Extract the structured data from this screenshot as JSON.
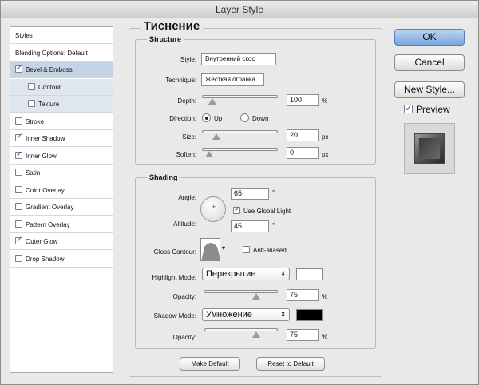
{
  "window": {
    "title": "Layer Style"
  },
  "sidebar": {
    "items": [
      {
        "label": "Styles",
        "checkbox": false,
        "checked": false,
        "selected": false,
        "sub": false
      },
      {
        "label": "Blending Options: Default",
        "checkbox": false,
        "checked": false,
        "selected": false,
        "sub": false
      },
      {
        "label": "Bevel & Emboss",
        "checkbox": true,
        "checked": true,
        "selected": true,
        "sub": false
      },
      {
        "label": "Contour",
        "checkbox": true,
        "checked": false,
        "selected": false,
        "sub": true
      },
      {
        "label": "Texture",
        "checkbox": true,
        "checked": false,
        "selected": false,
        "sub": true
      },
      {
        "label": "Stroke",
        "checkbox": true,
        "checked": false,
        "selected": false,
        "sub": false
      },
      {
        "label": "Inner Shadow",
        "checkbox": true,
        "checked": true,
        "selected": false,
        "sub": false
      },
      {
        "label": "Inner Glow",
        "checkbox": true,
        "checked": true,
        "selected": false,
        "sub": false
      },
      {
        "label": "Satin",
        "checkbox": true,
        "checked": false,
        "selected": false,
        "sub": false
      },
      {
        "label": "Color Overlay",
        "checkbox": true,
        "checked": false,
        "selected": false,
        "sub": false
      },
      {
        "label": "Gradient Overlay",
        "checkbox": true,
        "checked": false,
        "selected": false,
        "sub": false
      },
      {
        "label": "Pattern Overlay",
        "checkbox": true,
        "checked": false,
        "selected": false,
        "sub": false
      },
      {
        "label": "Outer Glow",
        "checkbox": true,
        "checked": true,
        "selected": false,
        "sub": false
      },
      {
        "label": "Drop Shadow",
        "checkbox": true,
        "checked": false,
        "selected": false,
        "sub": false
      }
    ]
  },
  "panel": {
    "title": "Тиснение"
  },
  "structure": {
    "label": "Structure",
    "style_label": "Style:",
    "style_value": "Внутренний скос",
    "technique_label": "Technique:",
    "technique_value": "Жёсткая огранка",
    "depth_label": "Depth:",
    "depth_value": "100",
    "depth_unit": "%",
    "depth_level": 0.05,
    "direction_label": "Direction:",
    "up_label": "Up",
    "down_label": "Down",
    "direction": "up",
    "size_label": "Size:",
    "size_value": "20",
    "size_unit": "px",
    "size_level": 0.12,
    "soften_label": "Soften:",
    "soften_value": "0",
    "soften_unit": "px",
    "soften_level": 0.0
  },
  "shading": {
    "label": "Shading",
    "angle_label": "Angle:",
    "angle_value": "65",
    "angle_unit": "°",
    "global_light_label": "Use Global Light",
    "global_light": true,
    "altitude_label": "Altitude:",
    "altitude_value": "45",
    "altitude_unit": "°",
    "gloss_label": "Gloss Contour:",
    "anti_aliased_label": "Anti-aliased",
    "anti_aliased": false,
    "highlight_mode_label": "Highlight Mode:",
    "highlight_mode_value": "Перекрытие",
    "highlight_color": "#ffffff",
    "highlight_opacity_label": "Opacity:",
    "highlight_opacity_value": "75",
    "highlight_opacity_unit": "%",
    "highlight_opacity_level": 0.75,
    "shadow_mode_label": "Shadow Mode:",
    "shadow_mode_value": "Умножение",
    "shadow_color": "#000000",
    "shadow_opacity_label": "Opacity:",
    "shadow_opacity_value": "75",
    "shadow_opacity_unit": "%",
    "shadow_opacity_level": 0.75
  },
  "footer": {
    "make_default": "Make Default",
    "reset_default": "Reset to Default"
  },
  "actions": {
    "ok": "OK",
    "cancel": "Cancel",
    "new_style": "New Style...",
    "preview_label": "Preview",
    "preview": true
  }
}
